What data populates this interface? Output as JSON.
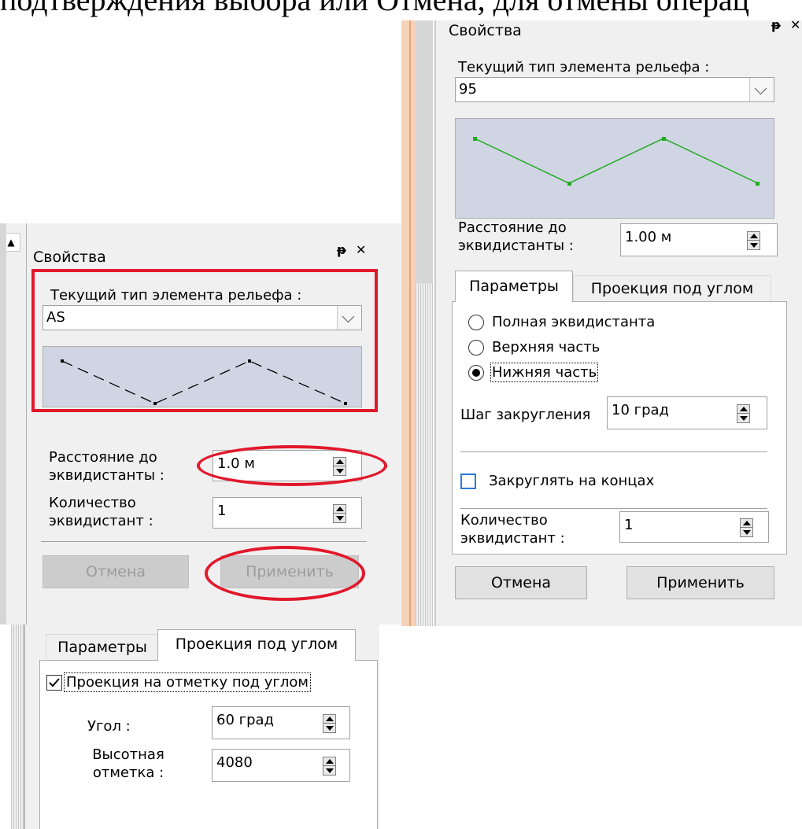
{
  "doc_text": "подтверждения выбора или Отмена, для отмены операц",
  "panel_left": {
    "title": "Свойства",
    "pin_glyph": "ᵽ",
    "close_glyph": "✕",
    "type_label": "Текущий тип элемента рельефа :",
    "type_value": "AS",
    "distance_label": "Расстояние до эквидистанты :",
    "distance_value": "1.0 м",
    "count_label": "Количество эквидистант :",
    "count_value": "1",
    "cancel_label": "Отмена",
    "apply_label": "Применить"
  },
  "panel_right": {
    "title": "Свойства",
    "pin_glyph": "ᵽ",
    "close_glyph": "✕",
    "type_label": "Текущий тип элемента рельефа :",
    "type_value": "95",
    "distance_label": "Расстояние до эквидистанты :",
    "distance_value": "1.00 м",
    "tabs": [
      "Параметры",
      "Проекция под углом"
    ],
    "radios": [
      "Полная эквидистанта",
      "Верхняя часть",
      "Нижняя часть"
    ],
    "selected_radio": "Нижняя часть",
    "rounding_label": "Шаг закругления",
    "rounding_value": "10 град",
    "round_ends_label": "Закруглять на концах",
    "round_ends_checked": false,
    "count_label": "Количество эквидистант :",
    "count_value": "1",
    "cancel_label": "Отмена",
    "apply_label": "Применить"
  },
  "panel_bottom": {
    "tabs": [
      "Параметры",
      "Проекция под углом"
    ],
    "projection_label": "Проекция на отметку под углом",
    "projection_checked": true,
    "angle_label": "Угол :",
    "angle_value": "60 град",
    "elevation_label": "Высотная отметка :",
    "elevation_value": "4080"
  },
  "colors": {
    "highlight_red": "#e2182b",
    "preview_bg": "#d0d5e3",
    "green_line": "#22aa22",
    "accent_blue": "#2b79d6"
  }
}
